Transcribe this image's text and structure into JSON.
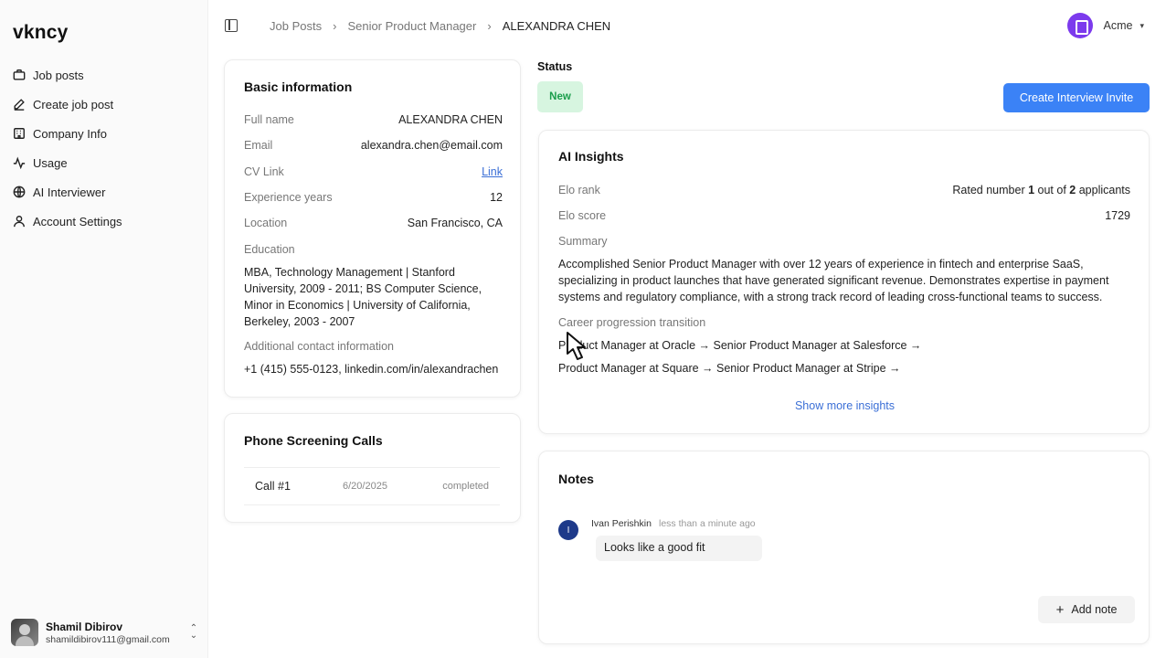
{
  "app": {
    "logo": "vkncy"
  },
  "sidebar": {
    "items": [
      {
        "label": "Job posts",
        "icon": "briefcase-icon"
      },
      {
        "label": "Create job post",
        "icon": "pen-icon"
      },
      {
        "label": "Company Info",
        "icon": "building-icon"
      },
      {
        "label": "Usage",
        "icon": "activity-icon"
      },
      {
        "label": "AI Interviewer",
        "icon": "globe-icon"
      },
      {
        "label": "Account Settings",
        "icon": "user-icon"
      }
    ],
    "user": {
      "name": "Shamil Dibirov",
      "email": "shamildibirov111@gmail.com"
    }
  },
  "header": {
    "breadcrumb": [
      "Job Posts",
      "Senior Product Manager",
      "ALEXANDRA CHEN"
    ],
    "org_name": "Acme",
    "org_color": "#7c3aed"
  },
  "basic_info": {
    "title": "Basic information",
    "full_name_label": "Full name",
    "full_name": "ALEXANDRA CHEN",
    "email_label": "Email",
    "email": "alexandra.chen@email.com",
    "cv_label": "CV Link",
    "cv_link_text": "Link",
    "experience_label": "Experience years",
    "experience": "12",
    "location_label": "Location",
    "location": "San Francisco, CA",
    "education_label": "Education",
    "education": "MBA, Technology Management | Stanford University, 2009 - 2011; BS Computer Science, Minor in Economics | University of California, Berkeley, 2003 - 2007",
    "contact_label": "Additional contact information",
    "contact": "+1 (415) 555-0123, linkedin.com/in/alexandrachen"
  },
  "phone_calls": {
    "title": "Phone Screening Calls",
    "calls": [
      {
        "name": "Call #1",
        "date": "6/20/2025",
        "status": "completed"
      }
    ]
  },
  "status": {
    "label": "Status",
    "value": "New",
    "color": "#1a9d4b"
  },
  "actions": {
    "create_invite": "Create Interview Invite",
    "accent": "#3b82f6"
  },
  "ai_insights": {
    "title": "AI Insights",
    "elo_rank_label": "Elo rank",
    "elo_rank_prefix": "Rated number ",
    "elo_rank_position": "1",
    "elo_rank_mid": " out of ",
    "elo_rank_total": "2",
    "elo_rank_suffix": " applicants",
    "elo_score_label": "Elo score",
    "elo_score": "1729",
    "summary_label": "Summary",
    "summary": "Accomplished Senior Product Manager with over 12 years of experience in fintech and enterprise SaaS, specializing in product launches that have generated significant revenue. Demonstrates expertise in payment systems and regulatory compliance, with a strong track record of leading cross-functional teams to success.",
    "career_label": "Career progression transition",
    "career": [
      "Product Manager at Oracle → Senior Product Manager at Salesforce →",
      "Product Manager at Square → Senior Product Manager at Stripe →"
    ],
    "show_more": "Show more insights"
  },
  "notes": {
    "title": "Notes",
    "items": [
      {
        "initial": "I",
        "author": "Ivan Perishkin",
        "time": "less than a minute ago",
        "text": "Looks like a good fit"
      }
    ],
    "add_note": "Add note"
  }
}
